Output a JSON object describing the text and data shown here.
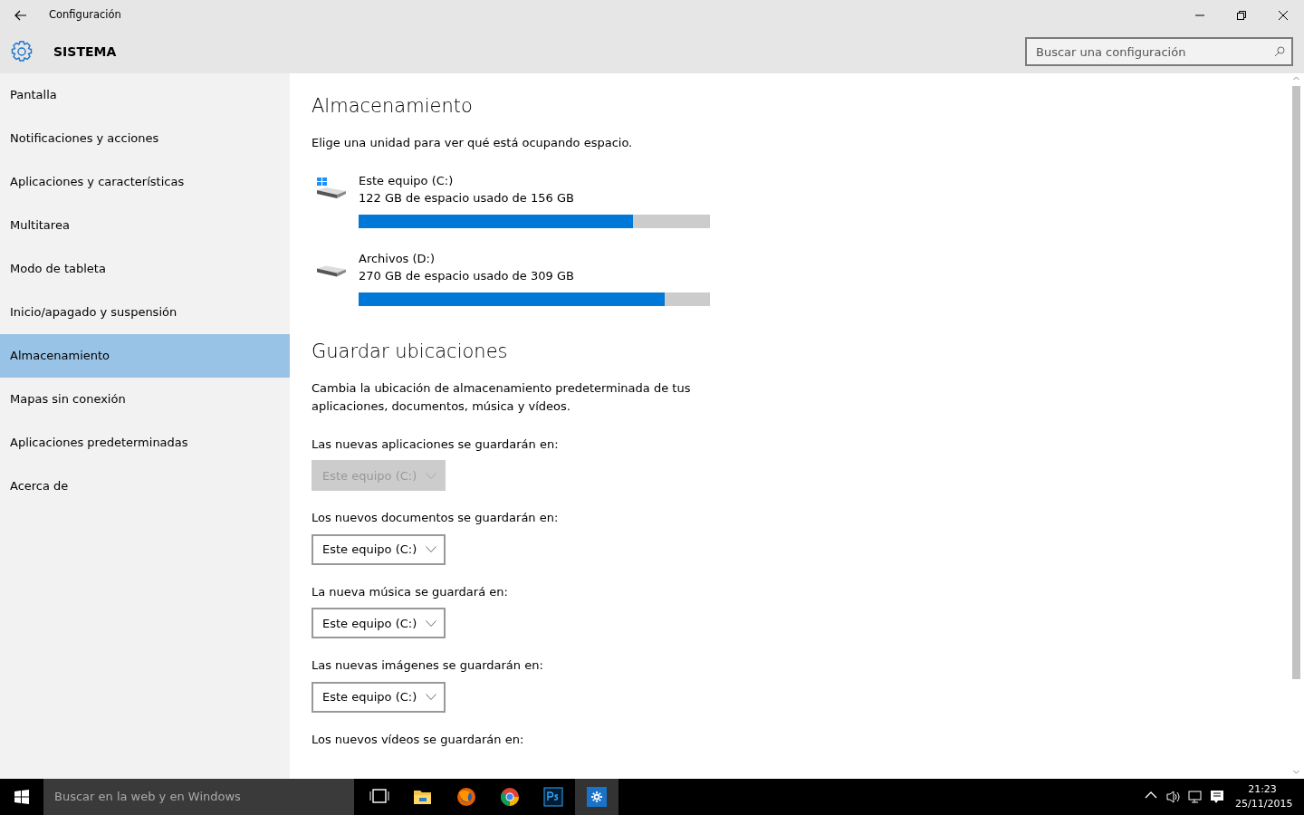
{
  "window": {
    "title": "Configuración"
  },
  "header": {
    "title": "SISTEMA",
    "search": {
      "placeholder": "Buscar una configuración"
    }
  },
  "sidebar": {
    "items": [
      {
        "label": "Pantalla",
        "selected": false
      },
      {
        "label": "Notificaciones y acciones",
        "selected": false
      },
      {
        "label": "Aplicaciones y características",
        "selected": false
      },
      {
        "label": "Multitarea",
        "selected": false
      },
      {
        "label": "Modo de tableta",
        "selected": false
      },
      {
        "label": "Inicio/apagado y suspensión",
        "selected": false
      },
      {
        "label": "Almacenamiento",
        "selected": true
      },
      {
        "label": "Mapas sin conexión",
        "selected": false
      },
      {
        "label": "Aplicaciones predeterminadas",
        "selected": false
      },
      {
        "label": "Acerca de",
        "selected": false
      }
    ]
  },
  "storage": {
    "heading": "Almacenamiento",
    "description": "Elige una unidad para ver qué está ocupando espacio.",
    "drives": [
      {
        "kind": "system",
        "name": "Este equipo (C:)",
        "usage": "122 GB de espacio usado de 156 GB",
        "level": 0.78
      },
      {
        "kind": "data",
        "name": "Archivos (D:)",
        "usage": "270 GB de espacio usado de 309 GB",
        "level": 0.87
      }
    ]
  },
  "save_locations": {
    "heading": "Guardar ubicaciones",
    "description": "Cambia la ubicación de almacenamiento predeterminada de tus aplicaciones, documentos, música y vídeos.",
    "items": [
      {
        "label": "Las nuevas aplicaciones se guardarán en:",
        "value": "Este equipo (C:)",
        "disabled": true
      },
      {
        "label": "Los nuevos documentos se guardarán en:",
        "value": "Este equipo (C:)",
        "disabled": false
      },
      {
        "label": "La nueva música se guardará en:",
        "value": "Este equipo (C:)",
        "disabled": false
      },
      {
        "label": "Las nuevas imágenes se guardarán en:",
        "value": "Este equipo (C:)",
        "disabled": false
      },
      {
        "label": "Los nuevos vídeos se guardarán en:"
      }
    ]
  },
  "taskbar": {
    "search_placeholder": "Buscar en la web y en Windows",
    "apps": [
      {
        "kind": "taskview",
        "selected": false
      },
      {
        "kind": "explorer",
        "selected": false
      },
      {
        "kind": "firefox",
        "selected": false
      },
      {
        "kind": "chrome",
        "selected": false
      },
      {
        "kind": "photoshop",
        "selected": false
      },
      {
        "kind": "settings",
        "selected": true
      }
    ],
    "time": "21:23",
    "date": "25/11/2015"
  }
}
